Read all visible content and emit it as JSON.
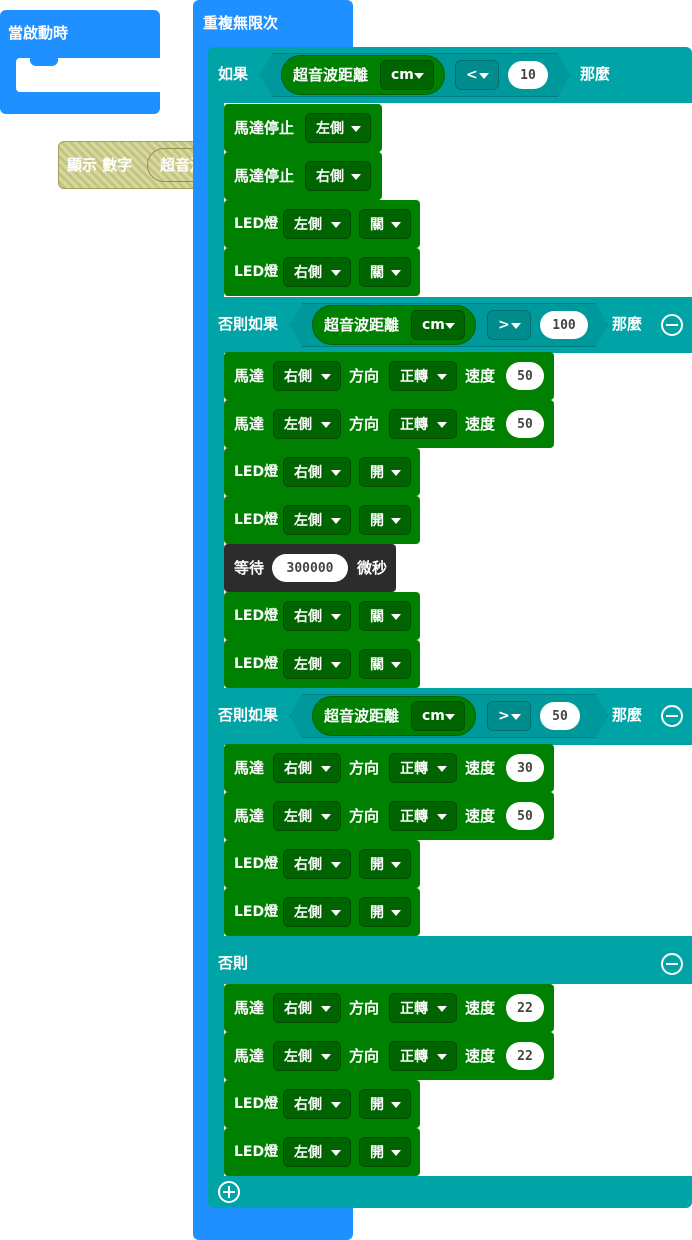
{
  "on_start": {
    "label": "當啟動時"
  },
  "show_number": {
    "label": "顯示 數字",
    "sensor": "超音波"
  },
  "forever": {
    "label": "重複無限次"
  },
  "branches": [
    {
      "keyword": "如果",
      "sensor": "超音波距離",
      "unit": "cm",
      "op": "<",
      "value": "10",
      "then": "那麼"
    },
    {
      "keyword": "否則如果",
      "sensor": "超音波距離",
      "unit": "cm",
      "op": ">",
      "value": "100",
      "then": "那麼"
    },
    {
      "keyword": "否則如果",
      "sensor": "超音波距離",
      "unit": "cm",
      "op": ">",
      "value": "50",
      "then": "那麼"
    },
    {
      "keyword": "否則"
    }
  ],
  "blocks": [
    {
      "kind": "stop",
      "label": "馬達停止",
      "side": "左側"
    },
    {
      "kind": "stop",
      "label": "馬達停止",
      "side": "右側"
    },
    {
      "kind": "led",
      "label": "LED燈",
      "side": "左側",
      "state": "關"
    },
    {
      "kind": "led",
      "label": "LED燈",
      "side": "右側",
      "state": "關"
    },
    {
      "kind": "motor",
      "label": "馬達",
      "side": "右側",
      "dir_label": "方向",
      "dir": "正轉",
      "speed_label": "速度",
      "speed": "50"
    },
    {
      "kind": "motor",
      "label": "馬達",
      "side": "左側",
      "dir_label": "方向",
      "dir": "正轉",
      "speed_label": "速度",
      "speed": "50"
    },
    {
      "kind": "led",
      "label": "LED燈",
      "side": "右側",
      "state": "開"
    },
    {
      "kind": "led",
      "label": "LED燈",
      "side": "左側",
      "state": "開"
    },
    {
      "kind": "wait",
      "label": "等待",
      "value": "300000",
      "unit": "微秒"
    },
    {
      "kind": "led",
      "label": "LED燈",
      "side": "右側",
      "state": "關"
    },
    {
      "kind": "led",
      "label": "LED燈",
      "side": "左側",
      "state": "關"
    },
    {
      "kind": "motor",
      "label": "馬達",
      "side": "右側",
      "dir_label": "方向",
      "dir": "正轉",
      "speed_label": "速度",
      "speed": "30"
    },
    {
      "kind": "motor",
      "label": "馬達",
      "side": "左側",
      "dir_label": "方向",
      "dir": "正轉",
      "speed_label": "速度",
      "speed": "50"
    },
    {
      "kind": "led",
      "label": "LED燈",
      "side": "右側",
      "state": "開"
    },
    {
      "kind": "led",
      "label": "LED燈",
      "side": "左側",
      "state": "開"
    },
    {
      "kind": "motor",
      "label": "馬達",
      "side": "右側",
      "dir_label": "方向",
      "dir": "正轉",
      "speed_label": "速度",
      "speed": "22"
    },
    {
      "kind": "motor",
      "label": "馬達",
      "side": "左側",
      "dir_label": "方向",
      "dir": "正轉",
      "speed_label": "速度",
      "speed": "22"
    },
    {
      "kind": "led",
      "label": "LED燈",
      "side": "右側",
      "state": "開"
    },
    {
      "kind": "led",
      "label": "LED燈",
      "side": "左側",
      "state": "開"
    }
  ],
  "colors": {
    "blue": "#1e90ff",
    "teal": "#00a4a6",
    "green": "#008000",
    "dark": "#2c2c2c"
  }
}
